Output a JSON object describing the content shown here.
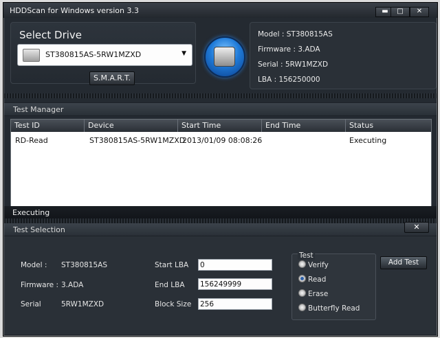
{
  "window": {
    "title": "HDDScan for Windows version 3.3",
    "buttons": [
      "minimize",
      "maximize",
      "close"
    ]
  },
  "drive": {
    "select_label": "Select Drive",
    "selected": "ST380815AS-5RW1MZXD",
    "smart_button": "S.M.A.R.T."
  },
  "info": {
    "model": "Model : ST380815AS",
    "firmware": "Firmware : 3.ADA",
    "serial": "Serial : 5RW1MZXD",
    "lba": "LBA : 156250000"
  },
  "test_manager": {
    "title": "Test Manager",
    "columns": [
      "Test ID",
      "Device",
      "Start Time",
      "End Time",
      "Status"
    ],
    "rows": [
      {
        "test_id": "RD-Read",
        "device": "ST380815AS-5RW1MZXD",
        "start_time": "2013/01/09 08:08:26",
        "end_time": "",
        "status": "Executing"
      }
    ],
    "status_text": "Executing"
  },
  "test_selection": {
    "title": "Test Selection",
    "close_label": "✕",
    "model_label": "Model :",
    "model_value": "ST380815AS",
    "firmware_label": "Firmware :",
    "firmware_value": "3.ADA",
    "serial_label": "Serial",
    "serial_value": "5RW1MZXD",
    "start_lba_label": "Start LBA",
    "start_lba_value": "0",
    "end_lba_label": "End LBA",
    "end_lba_value": "156249999",
    "block_size_label": "Block Size",
    "block_size_value": "256",
    "test_group_title": "Test",
    "options": [
      "Verify",
      "Read",
      "Erase",
      "Butterfly Read"
    ],
    "selected_option": "Read",
    "add_button": "Add Test"
  },
  "colors": {
    "window_bg": "#1d2228",
    "panel_bg": "#2a3037",
    "accent_blue": "#1f7ad8"
  }
}
